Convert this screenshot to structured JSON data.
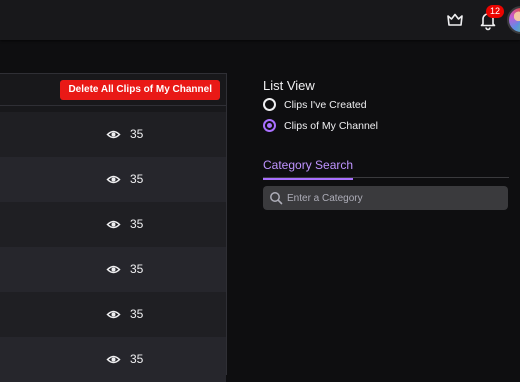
{
  "topbar": {
    "icons": [
      "crown-icon",
      "bell-icon"
    ],
    "notification_count": "12"
  },
  "clips_table": {
    "delete_all_label": "Delete All Clips of My Channel",
    "rows": [
      {
        "views": "35"
      },
      {
        "views": "35"
      },
      {
        "views": "35"
      },
      {
        "views": "35"
      },
      {
        "views": "35"
      },
      {
        "views": "35"
      }
    ]
  },
  "list_view": {
    "title": "List View",
    "options": [
      {
        "label": "Clips I've Created",
        "checked": false
      },
      {
        "label": "Clips of My Channel",
        "checked": true
      }
    ]
  },
  "category_search": {
    "tab_label": "Category Search",
    "placeholder": "Enter a Category",
    "value": ""
  },
  "colors": {
    "accent": "#a970ff",
    "danger": "#e91916",
    "background": "#0e0e10"
  }
}
